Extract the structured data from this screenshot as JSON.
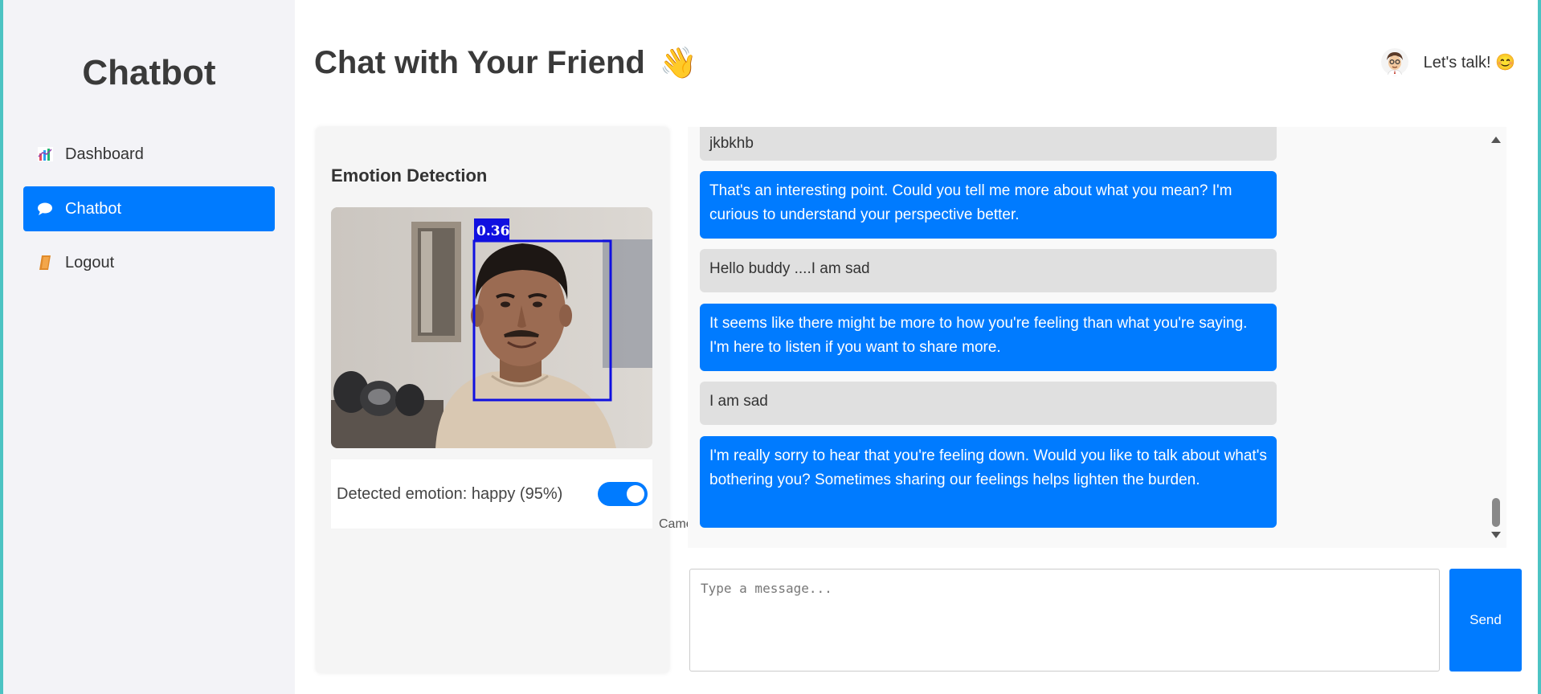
{
  "sidebar": {
    "brand": "Chatbot",
    "items": [
      {
        "label": "Dashboard",
        "icon": "bar-chart-icon"
      },
      {
        "label": "Chatbot",
        "icon": "speech-bubble-icon",
        "active": true
      },
      {
        "label": "Logout",
        "icon": "door-icon"
      }
    ]
  },
  "header": {
    "title": "Chat with Your Friend",
    "title_emoji": "👋",
    "greeting": "Let's talk! 😊"
  },
  "emotion": {
    "title": "Emotion Detection",
    "face_confidence": "0.36",
    "detected_text": "Detected emotion: happy (95%)",
    "camera_label": "Camera",
    "camera_enabled": true
  },
  "chat": {
    "messages": [
      {
        "role": "user",
        "text": "jkbkhb"
      },
      {
        "role": "bot",
        "text": "That's an interesting point. Could you tell me more about what you mean? I'm curious to understand your perspective better."
      },
      {
        "role": "user",
        "text": "Hello buddy ....I am sad"
      },
      {
        "role": "bot",
        "text": "It seems like there might be more to how you're feeling than what you're saying. I'm here to listen if you want to share more."
      },
      {
        "role": "user",
        "text": "I am sad"
      },
      {
        "role": "bot",
        "text": "I'm really sorry to hear that you're feeling down. Would you like to talk about what's bothering you? Sometimes sharing our feelings helps lighten the burden."
      }
    ],
    "input_placeholder": "Type a message...",
    "send_label": "Send"
  },
  "colors": {
    "accent": "#007bff",
    "sidebar_bg": "#f3f3f7",
    "user_bubble": "#e0e0e0",
    "face_box": "#1010e0"
  }
}
